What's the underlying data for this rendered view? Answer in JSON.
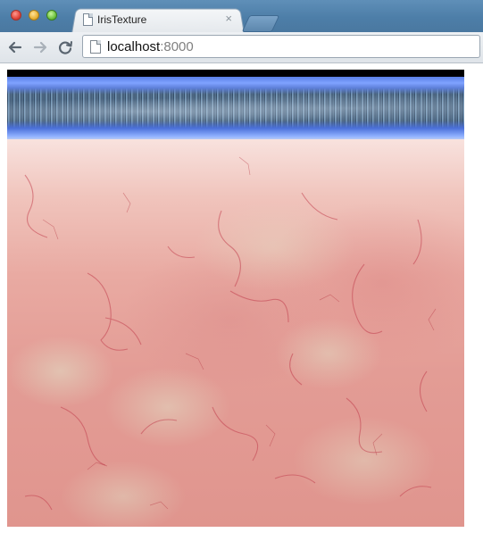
{
  "window": {
    "tab_title": "IrisTexture",
    "tab_close": "×"
  },
  "toolbar": {
    "url_host": "localhost",
    "url_port": ":8000"
  },
  "icons": {
    "close": "close-button",
    "minimize": "minimize-button",
    "maximize": "maximize-button",
    "tab_page": "page-icon",
    "back": "back-arrow-icon",
    "forward": "forward-arrow-icon",
    "reload": "reload-icon",
    "omnibox_page": "page-icon"
  },
  "colors": {
    "titlebar": "#4d7ea8",
    "band_blue": "#5a7fe6",
    "texture_pink": "#e39c95"
  }
}
